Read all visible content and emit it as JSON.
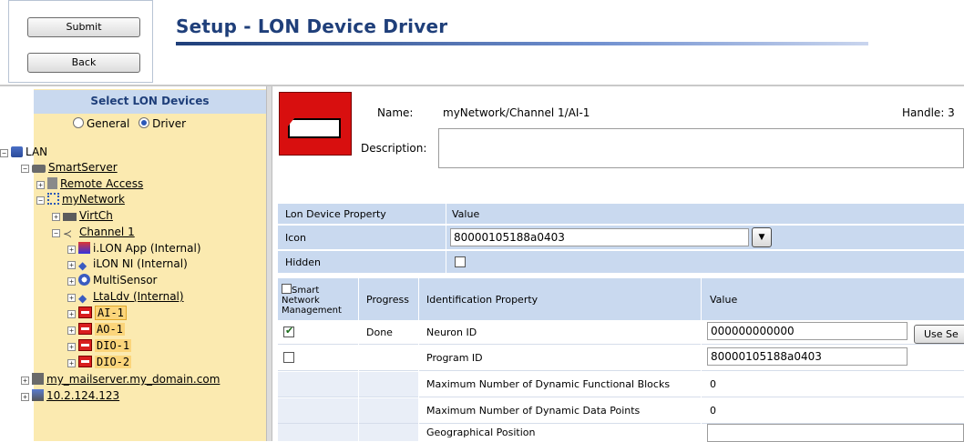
{
  "header": {
    "submit_label": "Submit",
    "back_label": "Back",
    "title": "Setup - LON Device Driver"
  },
  "tree": {
    "header": "Select LON Devices",
    "radio_general": "General",
    "radio_driver": "Driver",
    "selected_radio": "Driver",
    "lan": "LAN",
    "smartserver": "SmartServer",
    "remote_access": "Remote Access",
    "mynetwork": "myNetwork",
    "virtch": "VirtCh",
    "channel1": "Channel 1",
    "ilon_app": "i.LON App (Internal)",
    "ilon_ni": "iLON NI (Internal)",
    "multisensor": "MultiSensor",
    "ltaldv": "LtaLdv (Internal)",
    "ai1": "AI-1",
    "ao1": "AO-1",
    "dio1": "DIO-1",
    "dio2": "DIO-2",
    "mailserver": "my_mailserver.my_domain.com",
    "ip": "10.2.124.123"
  },
  "device": {
    "name_label": "Name:",
    "name_value": "myNetwork/Channel 1/AI-1",
    "handle_label": "Handle: 3",
    "description_label": "Description:"
  },
  "props": {
    "col_property": "Lon Device Property",
    "col_value": "Value",
    "icon_label": "Icon",
    "icon_value": "80000105188a0403",
    "hidden_label": "Hidden",
    "hidden_checked": false
  },
  "ident": {
    "col_smart": "Smart Network Management",
    "col_progress": "Progress",
    "col_property": "Identification Property",
    "col_value": "Value",
    "rows": [
      {
        "checked": true,
        "progress": "Done",
        "name": "Neuron ID",
        "value": "000000000000",
        "button": "Use Se"
      },
      {
        "checked": false,
        "progress": "",
        "name": "Program ID",
        "value": "80000105188a0403"
      },
      {
        "name": "Maximum Number of Dynamic Functional Blocks",
        "value": "0"
      },
      {
        "name": "Maximum Number of Dynamic Data Points",
        "value": "0"
      },
      {
        "name": "Geographical Position",
        "value": ""
      }
    ]
  }
}
